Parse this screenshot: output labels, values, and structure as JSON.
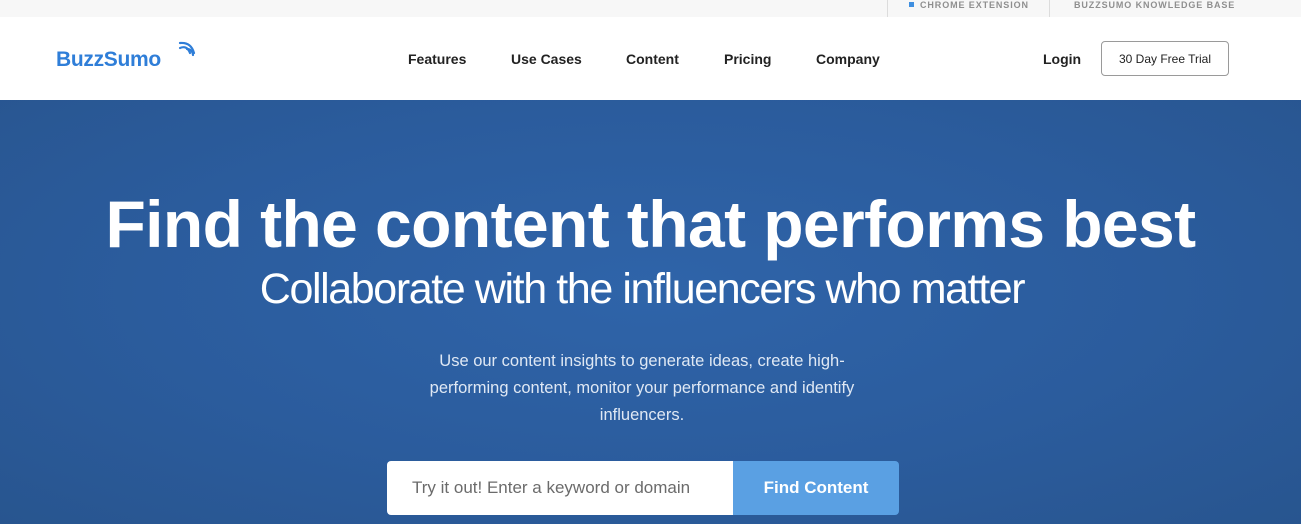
{
  "topbar": {
    "links": [
      {
        "label": "CHROME EXTENSION"
      },
      {
        "label": "BUZZSUMO KNOWLEDGE BASE"
      }
    ]
  },
  "header": {
    "logo": "BuzzSumo",
    "nav": [
      {
        "label": "Features"
      },
      {
        "label": "Use Cases"
      },
      {
        "label": "Content"
      },
      {
        "label": "Pricing"
      },
      {
        "label": "Company"
      }
    ],
    "login_label": "Login",
    "trial_label": "30 Day Free Trial"
  },
  "hero": {
    "title": "Find the content that performs best",
    "subtitle": "Collaborate with the influencers who matter",
    "description": "Use our content insights to generate ideas, create high-performing content, monitor your performance and identify influencers.",
    "search_placeholder": "Try it out! Enter a keyword or domain",
    "search_value": "",
    "button_label": "Find Content"
  },
  "colors": {
    "brand": "#2f7ed8",
    "hero_background": "#2b5c9d",
    "button": "#5aa0e3",
    "chrome_extension_marker": "#3f8fe0"
  }
}
